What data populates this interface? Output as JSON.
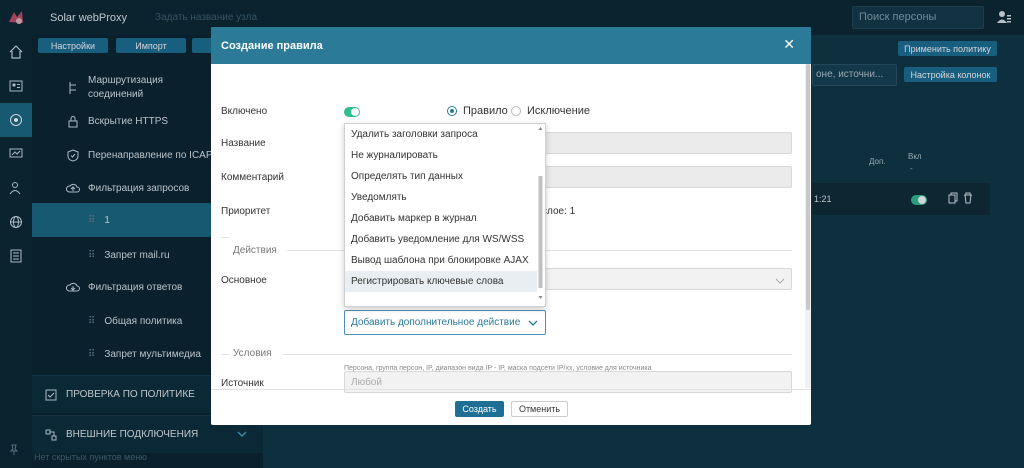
{
  "app": {
    "title": "Solar webProxy",
    "faded_title": "Задать название узла"
  },
  "search": {
    "placeholder": "Поиск персоны"
  },
  "sidebar": {
    "buttons": [
      "Настройки",
      "Импорт"
    ],
    "items": [
      {
        "label": "Маршрутизация",
        "label2": "соединений",
        "icon": "routing-icon"
      },
      {
        "label": "Вскрытие HTTPS",
        "icon": "lock-icon"
      },
      {
        "label": "Перенаправление по ICAP",
        "icon": "shield-icon"
      },
      {
        "label": "Фильтрация запросов",
        "icon": "cloud-upload-icon"
      },
      {
        "label": "1"
      },
      {
        "label": "Запрет mail.ru"
      },
      {
        "label": "Фильтрация ответов",
        "icon": "cloud-download-icon"
      },
      {
        "label": "Общая политика"
      },
      {
        "label": "Запрет мультимедиа"
      }
    ],
    "sections": [
      "ПРОВЕРКА ПО ПОЛИТИКЕ",
      "ВНЕШНИЕ ПОДКЛЮЧЕНИЯ"
    ],
    "hidden_note": "Нет скрытых пунктов меню"
  },
  "right": {
    "apply_policy": "Применить политику",
    "columns_settings": "Настройка колонок",
    "filter_value": "оне, источни...",
    "col_extra": "Доп.",
    "col_enabled": "Вкл",
    "col_enabled_sub": "-",
    "row_time": "1:21"
  },
  "modal": {
    "title": "Создание правила",
    "labels": {
      "enabled": "Включено",
      "name": "Название",
      "comment": "Комментарий",
      "priority": "Приоритет",
      "main": "Основное",
      "source": "Источник"
    },
    "radio_rule": "Правило",
    "radio_exception": "Исключение",
    "priority_text": "слое: 1",
    "section_actions": "Действия",
    "section_conditions": "Условия",
    "dropdown_options": [
      "Удалить заголовки запроса",
      "Не журналировать",
      "Определять тип данных",
      "Уведомлять",
      "Добавить маркер в журнал",
      "Добавить уведомление для WS/WSS",
      "Вывод шаблона при блокировке AJAX",
      "Регистрировать ключевые слова"
    ],
    "add_action": "Добавить дополнительное действие",
    "source_placeholder": "Любой",
    "source_hint": "Персона, группа персон, IP, диапазон вида IP - IP, маска подсети IP/xx, условие для источника",
    "create": "Создать",
    "cancel": "Отменить"
  },
  "colors": {
    "accent": "#2a7a98",
    "button": "#1d6f95",
    "toggle": "#2fbf8f"
  }
}
